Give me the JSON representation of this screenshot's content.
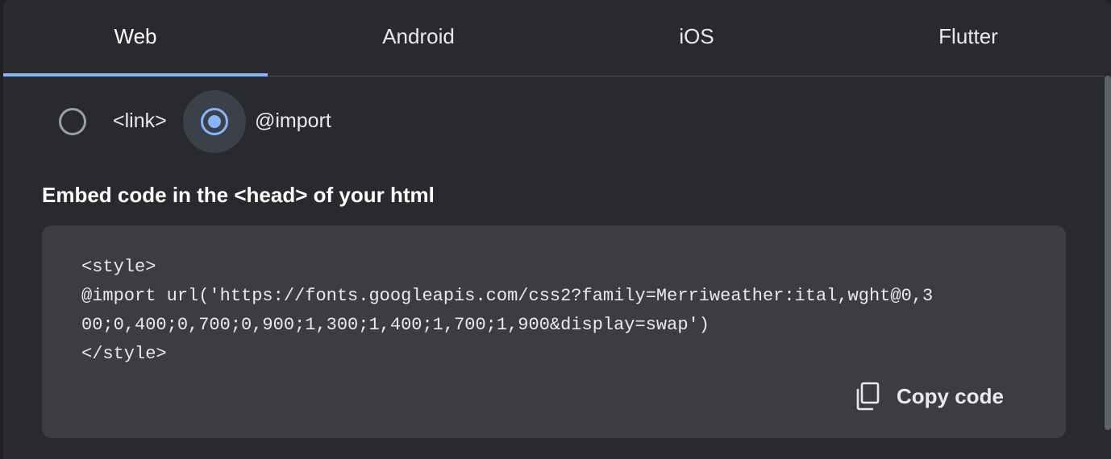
{
  "tabs": [
    {
      "label": "Web",
      "active": true
    },
    {
      "label": "Android",
      "active": false
    },
    {
      "label": "iOS",
      "active": false
    },
    {
      "label": "Flutter",
      "active": false
    }
  ],
  "embed_options": [
    {
      "label": "<link>",
      "selected": false
    },
    {
      "label": "@import",
      "selected": true
    }
  ],
  "heading": "Embed code in the <head> of your html",
  "code": {
    "lines": [
      "<style>",
      "@import url('https://fonts.googleapis.com/css2?family=Merriweather:ital,wght@0,3",
      "00;0,400;0,700;0,900;1,300;1,400;1,700;1,900&display=swap')",
      "</style>"
    ]
  },
  "copy_button": {
    "label": "Copy code",
    "icon": "copy-icon"
  },
  "colors": {
    "accent": "#8ab4f8",
    "panel_bg": "#292a2d",
    "code_bg": "#3c3d41"
  }
}
